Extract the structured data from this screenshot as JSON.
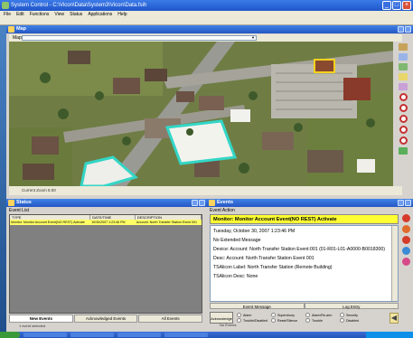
{
  "window": {
    "title": "System Control - C:\\Vicon\\Data\\System3\\Vicon\\Data.fsih"
  },
  "menu": [
    "File",
    "Edit",
    "Functions",
    "View",
    "Status",
    "Applications",
    "Help"
  ],
  "map_panel": {
    "title": "Map",
    "map_label": "Map",
    "status": "Current Zoom 8.00"
  },
  "status_panel": {
    "title": "Status",
    "list_label": "Event List",
    "columns": [
      "TYPE",
      "DATE/TIME",
      "DESCRIPTION"
    ],
    "rows": [
      {
        "type": "Monitor: Monitor Account Event(NO REST) Activate",
        "datetime": "10/30/2007 1:23:46 PM",
        "description": "Account: North Transfer Station Event 001"
      }
    ],
    "tabs": [
      "New Events",
      "Acknowledged Events",
      "All Events"
    ],
    "footer": "1 event selected"
  },
  "events_panel": {
    "title": "Events",
    "action_label": "Event Action",
    "banner": "Monitor: Monitor Account Event(NO REST) Activate",
    "body": [
      "Tuesday, October 30, 2007 1:23:46 PM",
      "No Extended Message",
      "Device: Account: North Transfer Station Event:001 (01-R01-L01-A0000-B0018300)",
      "Desc: Account: North Transfer Station Event 001",
      "TSAlicon Label: North Transfer Station (Remote Building)",
      "TSAlicon Desc: None"
    ],
    "tabs": [
      "Event Message",
      "Log Entry"
    ],
    "ack_label": "Acknowledge",
    "radios": [
      "Alarm",
      "Supervisory",
      "Alarm/Re-arm",
      "Security",
      "Trouble/Disabled",
      "Reset/Silence",
      "Trouble",
      "Disabled"
    ],
    "footer": "No Events"
  },
  "colors": {
    "banner": "#ffff33",
    "event_row": "#ffff66",
    "titlebar": "#2457c4"
  }
}
